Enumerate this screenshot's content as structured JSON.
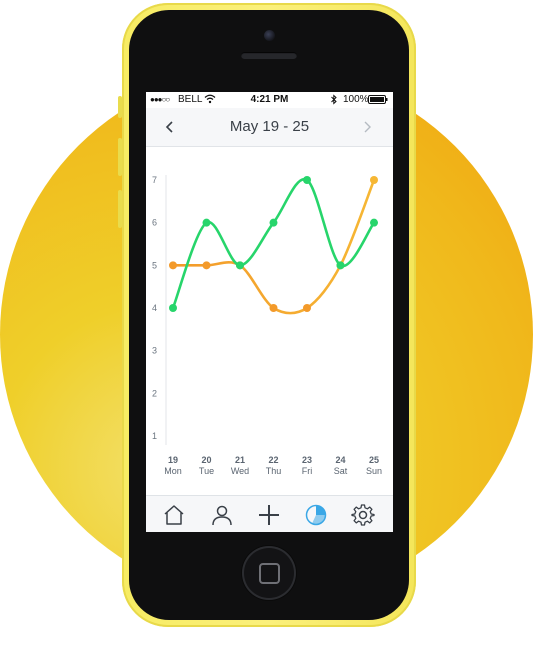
{
  "status_bar": {
    "signal": "●●●○○",
    "carrier": "BELL",
    "time": "4:21 PM",
    "battery": "100%"
  },
  "header": {
    "title": "May 19 - 25",
    "prev_icon": "chevron-left-icon",
    "next_icon": "chevron-right-icon"
  },
  "tabs": [
    {
      "name": "home",
      "icon": "home-icon",
      "active": false
    },
    {
      "name": "profile",
      "icon": "user-icon",
      "active": false
    },
    {
      "name": "add",
      "icon": "plus-icon",
      "active": false
    },
    {
      "name": "stats",
      "icon": "pie-chart-icon",
      "active": true
    },
    {
      "name": "settings",
      "icon": "gear-icon",
      "active": false
    }
  ],
  "colors": {
    "green": "#27d56b",
    "orange": "#f39a2a",
    "orange_light": "#f6b734",
    "active_tab": "#3aa7e6",
    "inactive_tab": "#3a4048"
  },
  "chart_data": {
    "type": "line",
    "categories": [
      {
        "day": "19",
        "weekday": "Mon"
      },
      {
        "day": "20",
        "weekday": "Tue"
      },
      {
        "day": "21",
        "weekday": "Wed"
      },
      {
        "day": "22",
        "weekday": "Thu"
      },
      {
        "day": "23",
        "weekday": "Fri"
      },
      {
        "day": "24",
        "weekday": "Sat"
      },
      {
        "day": "25",
        "weekday": "Sun"
      }
    ],
    "yticks": [
      "1",
      "2",
      "3",
      "4",
      "5",
      "6",
      "7"
    ],
    "ylim": [
      1,
      7
    ],
    "series": [
      {
        "values": [
          4,
          6,
          5,
          6,
          7,
          5,
          6
        ],
        "color": "#27d56b"
      },
      {
        "values": [
          5,
          5,
          5,
          4,
          4,
          5,
          7
        ],
        "color": "#f39a2a"
      }
    ],
    "grid": false,
    "smooth": true
  }
}
